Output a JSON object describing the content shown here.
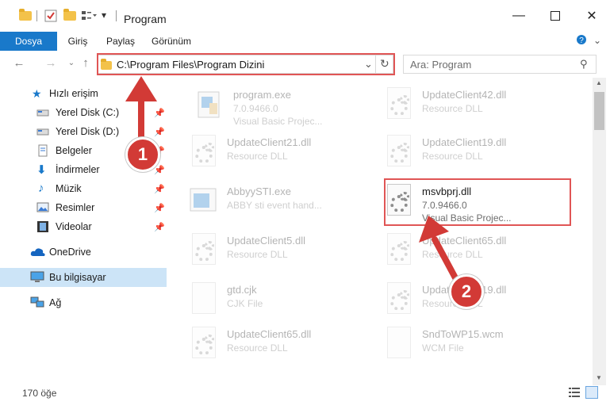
{
  "window": {
    "title": "Program"
  },
  "ribbon": {
    "tabs": [
      "Dosya",
      "Giriş",
      "Paylaş",
      "Görünüm"
    ]
  },
  "address": {
    "path": "C:\\Program Files\\Program Dizini"
  },
  "search": {
    "placeholder": "Ara: Program"
  },
  "sidebar": {
    "quick_access": "Hızlı erişim",
    "items": [
      {
        "label": "Yerel Disk (C:)",
        "icon": "drive-icon"
      },
      {
        "label": "Yerel Disk (D:)",
        "icon": "drive-icon"
      },
      {
        "label": "Belgeler",
        "icon": "documents-icon"
      },
      {
        "label": "İndirmeler",
        "icon": "download-icon"
      },
      {
        "label": "Müzik",
        "icon": "music-icon"
      },
      {
        "label": "Resimler",
        "icon": "pictures-icon"
      },
      {
        "label": "Videolar",
        "icon": "videos-icon"
      }
    ],
    "onedrive": "OneDrive",
    "thispc": "Bu bilgisayar",
    "network": "Ağ"
  },
  "files": [
    {
      "name": "program.exe",
      "line2": "7.0.9466.0",
      "line3": "Visual Basic Projec..."
    },
    {
      "name": "UpdateClient42.dll",
      "line2": "Resource DLL",
      "line3": ""
    },
    {
      "name": "UpdateClient21.dll",
      "line2": "Resource DLL",
      "line3": ""
    },
    {
      "name": "UpdateClient19.dll",
      "line2": "Resource DLL",
      "line3": ""
    },
    {
      "name": "AbbyySTI.exe",
      "line2": "ABBY sti event hand...",
      "line3": ""
    },
    {
      "name": "msvbprj.dll",
      "line2": "7.0.9466.0",
      "line3": "Visual Basic Projec..."
    },
    {
      "name": "UpdateClient5.dll",
      "line2": "Resource DLL",
      "line3": ""
    },
    {
      "name": "UpdateClient65.dll",
      "line2": "Resource DLL",
      "line3": ""
    },
    {
      "name": "gtd.cjk",
      "line2": "CJK File",
      "line3": ""
    },
    {
      "name": "UpdateClient19.dll",
      "line2": "Resource DLL",
      "line3": ""
    },
    {
      "name": "UpdateClient65.dll",
      "line2": "Resource DLL",
      "line3": ""
    },
    {
      "name": "SndToWP15.wcm",
      "line2": "WCM File",
      "line3": ""
    }
  ],
  "status": {
    "count": "170 öğe"
  },
  "callouts": {
    "one": "1",
    "two": "2"
  },
  "colors": {
    "accent": "#1979ca",
    "highlight": "#e05555",
    "selection": "#cce4f7",
    "callout": "#d23a36"
  }
}
